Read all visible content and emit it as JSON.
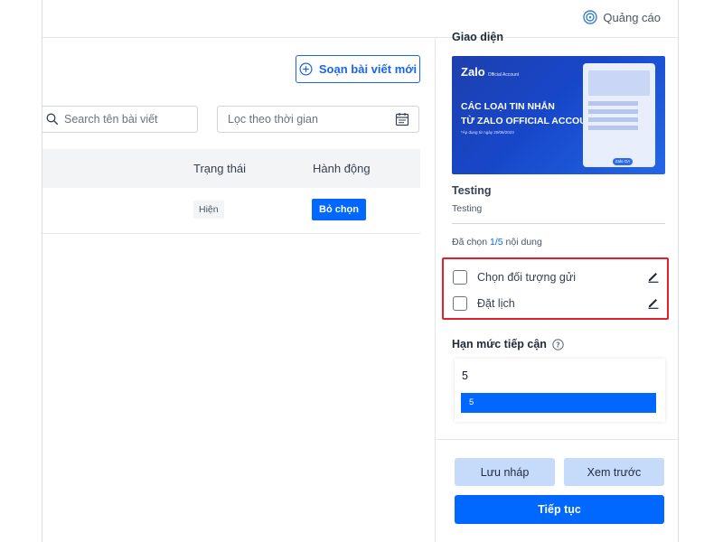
{
  "topbar": {
    "ads_label": "Quảng cáo"
  },
  "main": {
    "compose_label": "Soạn bài viết mới",
    "search_placeholder": "Search tên bài viết",
    "date_filter_placeholder": "Lọc theo thời gian",
    "columns": [
      "Trạng thái",
      "Hành động"
    ],
    "rows": [
      {
        "status": "Hiện",
        "action": "Bỏ chọn"
      }
    ]
  },
  "panel": {
    "section_title": "Giao diện",
    "banner": {
      "logo": "Zalo",
      "logo_small": "Official Account",
      "line1": "CÁC LOẠI TIN NHẮN",
      "line2": "TỪ ZALO OFFICIAL ACCOUNT",
      "note": "*Áp dụng từ ngày 20/06/2023",
      "pill": "Zalo OA"
    },
    "item_title": "Testing",
    "item_subtitle": "Testing",
    "selected_prefix": "Đã chọn ",
    "selected_count": "1/5",
    "selected_suffix": " nội dung",
    "options": [
      "Chọn đối tượng gửi",
      "Đặt lịch"
    ],
    "limit": {
      "title": "Hạn mức tiếp cận",
      "value": "5",
      "bar_label": "5",
      "fill_fraction": 1.0
    },
    "footer": {
      "draft": "Lưu nháp",
      "preview": "Xem trước",
      "continue": "Tiếp tục"
    }
  },
  "colors": {
    "primary": "#0068ff",
    "secondary_button": "#c6dbf9",
    "highlight_border": "#e0202a"
  }
}
